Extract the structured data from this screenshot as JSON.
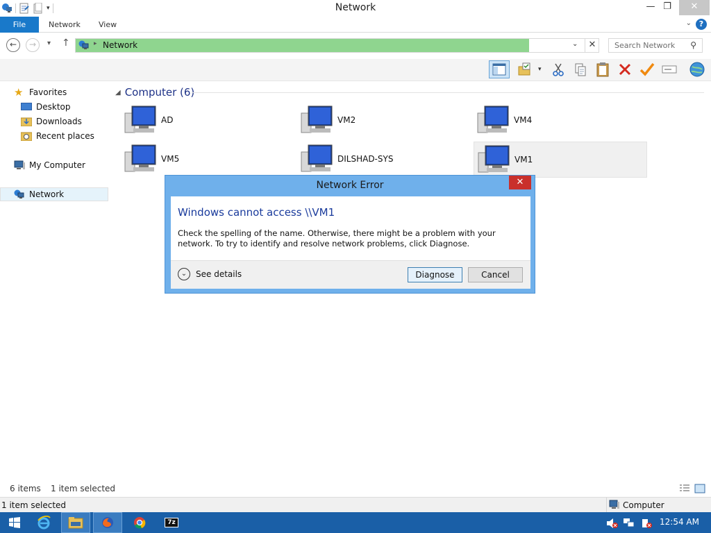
{
  "window": {
    "title": "Network",
    "minimize": "—",
    "restore": "❐",
    "close": "✕"
  },
  "ribbon": {
    "tabs": [
      "File",
      "Network",
      "View"
    ],
    "help": "?"
  },
  "address": {
    "crumb": "Network",
    "search_placeholder": "Search Network"
  },
  "nav_pane": {
    "favorites": "Favorites",
    "desktop": "Desktop",
    "downloads": "Downloads",
    "recent": "Recent places",
    "my_computer": "My Computer",
    "network": "Network"
  },
  "content": {
    "group_title": "Computer (6)",
    "computers": [
      {
        "name": "AD",
        "selected": false
      },
      {
        "name": "VM2",
        "selected": false
      },
      {
        "name": "VM4",
        "selected": false
      },
      {
        "name": "VM5",
        "selected": false
      },
      {
        "name": "DILSHAD-SYS",
        "selected": false
      },
      {
        "name": "VM1",
        "selected": true
      }
    ]
  },
  "status": {
    "items": "6 items",
    "selected": "1 item selected",
    "bottom_selected": "1 item selected",
    "location": "Computer"
  },
  "dialog": {
    "title": "Network Error",
    "close": "✕",
    "main_instruction": "Windows cannot access \\\\VM1",
    "message": "Check the spelling of the name. Otherwise, there might be a problem with your network. To try to identify and resolve network problems, click Diagnose.",
    "see_details": "See details",
    "diagnose": "Diagnose",
    "cancel": "Cancel"
  },
  "taskbar": {
    "clock": "12:54 AM",
    "seven_zip_label": "7z"
  },
  "colors": {
    "accent": "#1979ca",
    "address_fill": "#8fd58f",
    "dialog_frame": "#6fb0eb",
    "taskbar": "#1a5fa7",
    "close_red": "#c9302c"
  }
}
